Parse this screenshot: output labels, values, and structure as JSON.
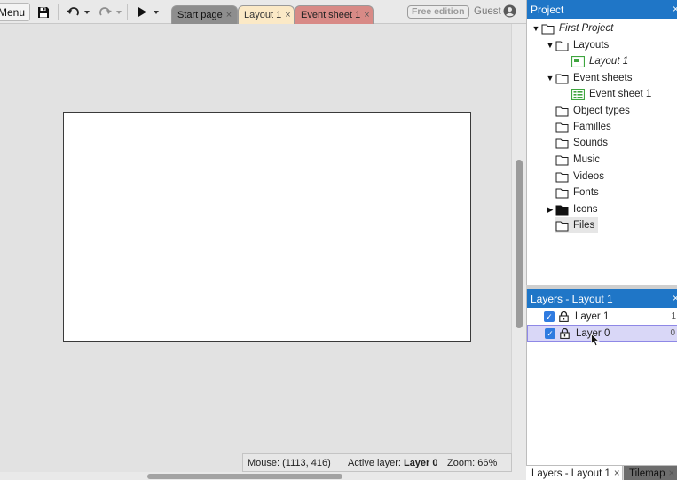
{
  "toolbar": {
    "menu_label": "Menu",
    "tabs": [
      {
        "label": "Start page",
        "close": "×"
      },
      {
        "label": "Layout 1",
        "close": "×"
      },
      {
        "label": "Event sheet 1",
        "close": "×"
      }
    ],
    "free_edition_label": "Free edition",
    "guest_label": "Guest"
  },
  "project": {
    "header": "Project",
    "close": "×",
    "tree": {
      "root": "First Project",
      "layouts": "Layouts",
      "layout_1": "Layout 1",
      "event_sheets": "Event sheets",
      "event_sheet_1": "Event sheet 1",
      "object_types": "Object types",
      "families": "Familles",
      "sounds": "Sounds",
      "music": "Music",
      "videos": "Videos",
      "fonts": "Fonts",
      "icons": "Icons",
      "files": "Files"
    }
  },
  "layers": {
    "header": "Layers - Layout 1",
    "close": "×",
    "items": [
      {
        "label": "Layer 1",
        "checked": true,
        "number": "1"
      },
      {
        "label": "Layer 0",
        "checked": true,
        "number": "0"
      }
    ]
  },
  "status": {
    "mouse": "Mouse: (1113, 416)",
    "active_prefix": "Active layer: ",
    "active_value": "Layer 0",
    "zoom": "Zoom: 66%"
  },
  "bottom_tabs": [
    {
      "label": "Layers - Layout 1",
      "close": "×"
    },
    {
      "label": "Tilemap",
      "close": "×"
    }
  ],
  "colors": {
    "panel_header": "#1f76c7",
    "tab_layout": "#fbe9c6",
    "tab_event": "#d88a86",
    "checkbox": "#2f7be0",
    "selection": "#d9d7f7"
  },
  "icons": [
    "save-icon",
    "undo-icon",
    "redo-icon",
    "play-icon",
    "user-icon",
    "folder-icon",
    "layout-icon",
    "event-sheet-icon",
    "lock-icon",
    "checkbox-icon",
    "mouse-cursor-icon"
  ]
}
